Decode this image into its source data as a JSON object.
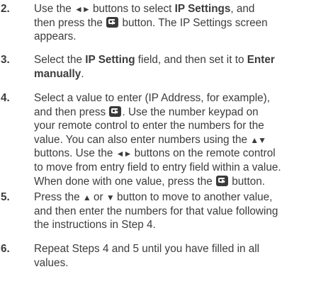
{
  "steps": [
    {
      "number": "2.",
      "lines": [
        [
          "Use the ",
          "◄►",
          " buttons to select ",
          "IP Settings",
          ", and"
        ],
        [
          "then press the ",
          "",
          " button. The IP Settings screen"
        ],
        [
          "appears."
        ]
      ]
    },
    {
      "number": "3.",
      "lines": [
        [
          "Select the ",
          "IP Setting",
          " field, and then set it to ",
          "Enter"
        ],
        [
          "manually",
          "."
        ]
      ]
    },
    {
      "number": "4.",
      "lines": [
        [
          "Select a value to enter (IP Address, for example),"
        ],
        [
          "and then press ",
          "",
          ". Use the number keypad on"
        ],
        [
          "your remote control to enter the numbers for the"
        ],
        [
          "value. You can also enter numbers using the ",
          "▲▼"
        ],
        [
          "buttons. Use the ",
          "◄►",
          " buttons on the remote control"
        ],
        [
          "to move from entry field to entry field within a value."
        ],
        [
          "When done with one value, press the ",
          "",
          " button."
        ]
      ]
    },
    {
      "number": "5.",
      "lines": [
        [
          "Press the ",
          "▲",
          " or ",
          "▼",
          " button to move to another value,"
        ],
        [
          "and then enter the numbers for that value following"
        ],
        [
          "the instructions in Step 4."
        ]
      ]
    },
    {
      "number": "6.",
      "lines": [
        [
          "Repeat Steps 4 and 5 until you have filled in all"
        ],
        [
          "values."
        ]
      ]
    }
  ],
  "icons": {
    "enter_button": "enter-button-icon",
    "left_right_arrows": "left-right-arrow-icon",
    "up_down_arrows": "up-down-arrow-icon"
  },
  "colors": {
    "text": "#3c3c3c",
    "icon_fill": "#3a3a3a"
  }
}
